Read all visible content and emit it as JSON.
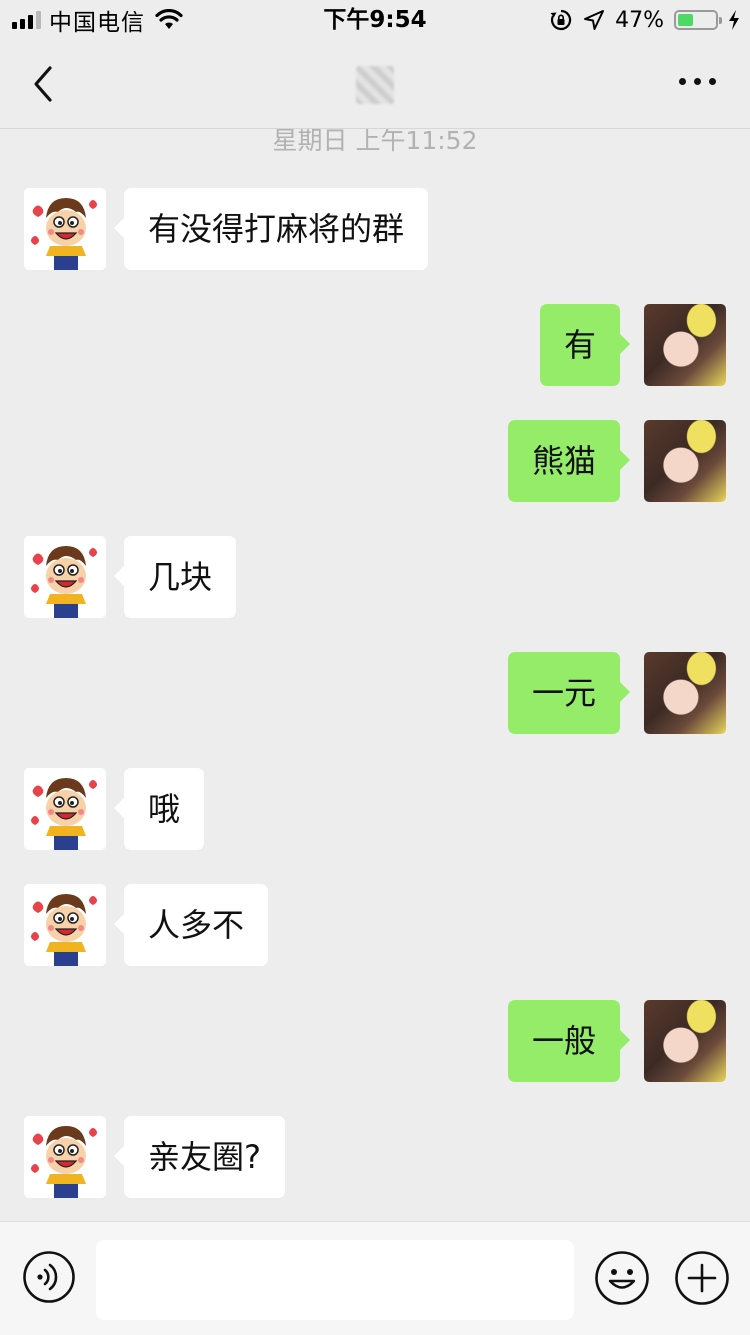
{
  "status_bar": {
    "carrier": "中国电信",
    "time": "下午9:54",
    "battery_percent": "47%",
    "battery_level": 0.47,
    "icons": [
      "signal-icon",
      "wifi-icon",
      "orientation-lock-icon",
      "location-arrow-icon",
      "battery-icon",
      "charging-bolt-icon"
    ]
  },
  "nav": {
    "icons": [
      "back-chevron-icon",
      "more-dots-icon"
    ]
  },
  "chat": {
    "timestamp": "星期日 上午11:52",
    "messages": [
      {
        "side": "left",
        "text": "有没得打麻将的群"
      },
      {
        "side": "right",
        "text": "有"
      },
      {
        "side": "right",
        "text": "熊猫"
      },
      {
        "side": "left",
        "text": "几块"
      },
      {
        "side": "right",
        "text": "一元"
      },
      {
        "side": "left",
        "text": "哦"
      },
      {
        "side": "left",
        "text": "人多不"
      },
      {
        "side": "right",
        "text": "一般"
      },
      {
        "side": "left",
        "text": "亲友圈?"
      }
    ]
  },
  "input_bar": {
    "text_value": "",
    "icons": [
      "voice-icon",
      "emoji-icon",
      "plus-icon"
    ]
  },
  "colors": {
    "background": "#ededed",
    "sent_bubble": "#95ec69",
    "received_bubble": "#ffffff",
    "battery_green": "#4cd964"
  }
}
